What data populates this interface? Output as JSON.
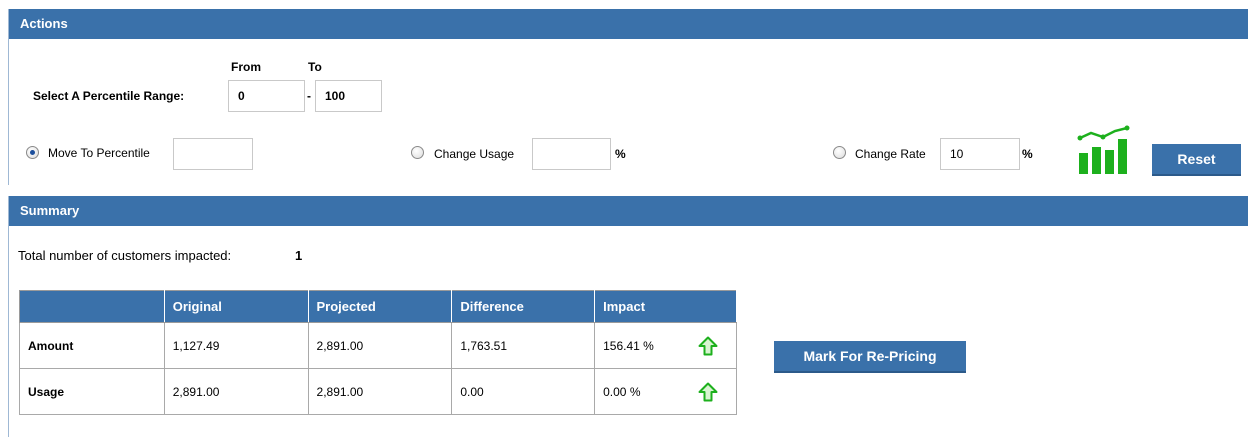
{
  "actions": {
    "header": "Actions",
    "range": {
      "from_label": "From",
      "to_label": "To",
      "label": "Select A Percentile Range:",
      "from_value": "0",
      "separator": "-",
      "to_value": "100"
    },
    "options": {
      "move_label": "Move To Percentile",
      "move_value": "",
      "usage_label": "Change Usage",
      "usage_value": "",
      "usage_unit": "%",
      "rate_label": "Change Rate",
      "rate_value": "10",
      "rate_unit": "%",
      "selected": "move"
    },
    "reset_label": "Reset"
  },
  "summary": {
    "header": "Summary",
    "total_label": "Total number of customers impacted:",
    "total_value": "1",
    "columns": [
      "",
      "Original",
      "Projected",
      "Difference",
      "Impact"
    ],
    "rows": [
      {
        "label": "Amount",
        "original": "1,127.49",
        "projected": "2,891.00",
        "difference": "1,763.51",
        "impact": "156.41 %",
        "trend": "up-arrow-icon"
      },
      {
        "label": "Usage",
        "original": "2,891.00",
        "projected": "2,891.00",
        "difference": "0.00",
        "impact": "0.00 %",
        "trend": "up-arrow-icon"
      }
    ],
    "mark_button": "Mark For Re-Pricing"
  },
  "colors": {
    "header_blue": "#3a71aa",
    "trend_green": "#1db01d"
  }
}
